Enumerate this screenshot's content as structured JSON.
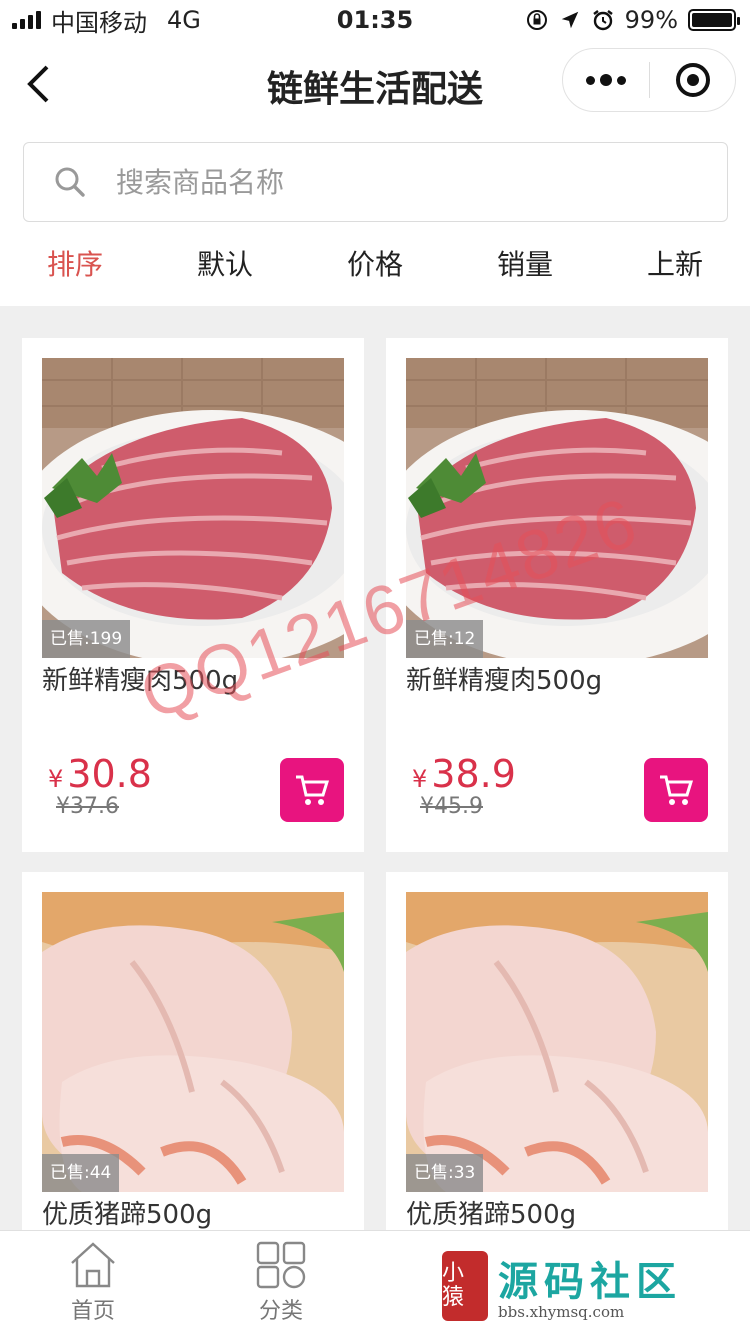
{
  "status_bar": {
    "carrier": "中国移动",
    "network": "4G",
    "time": "01:35",
    "battery_text": "99%",
    "battery_level": 0.99
  },
  "nav": {
    "title": "链鲜生活配送"
  },
  "search": {
    "placeholder": "搜索商品名称"
  },
  "sort_tabs": [
    {
      "label": "排序",
      "active": true
    },
    {
      "label": "默认"
    },
    {
      "label": "价格"
    },
    {
      "label": "销量"
    },
    {
      "label": "上新"
    }
  ],
  "products": [
    {
      "name": "新鲜精瘦肉500g",
      "sold": "已售:199",
      "price": "30.8",
      "old_price": "¥37.6"
    },
    {
      "name": "新鲜精瘦肉500g",
      "sold": "已售:12",
      "price": "38.9",
      "old_price": "¥45.9"
    },
    {
      "name": "优质猪蹄500g",
      "sold": "已售:44"
    },
    {
      "name": "优质猪蹄500g",
      "sold": "已售:33"
    }
  ],
  "currency": "¥",
  "watermark": "QQ1216714826",
  "tab_bar": {
    "home": "首页",
    "category": "分类"
  },
  "brand": {
    "seal": "小 猿",
    "name": "源码社区",
    "url": "bbs.xhymsq.com"
  },
  "colors": {
    "accent": "#d9534f",
    "price": "#d9314a",
    "cart": "#e8147f",
    "brand": "#1ca6a1"
  }
}
